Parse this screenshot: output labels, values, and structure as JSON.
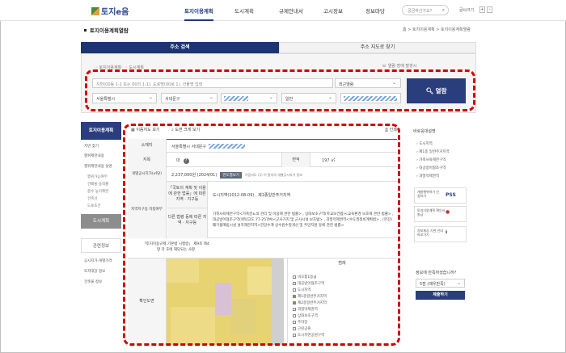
{
  "header": {
    "logo_text": "토지e음",
    "nav": [
      "토지이용계획",
      "도시계획",
      "규제안내서",
      "고시정보",
      "정보마당"
    ],
    "search_placeholder": "궁금하신가요?",
    "font_label": "글씨크기",
    "font_plus": "+",
    "font_minus": "-"
  },
  "page": {
    "title": "토지이용계획열람",
    "breadcrumb": [
      "홈",
      ">",
      "토지이용계획",
      ">",
      "토지이용계획열람"
    ]
  },
  "tabs": {
    "address_search": "주소 검색",
    "map_search": "주소 지도로 찾기"
  },
  "search": {
    "radio_land": "토지이용계획",
    "radio_city": "도시계획",
    "help_text": "열람 장애 발생시",
    "address_placeholder": "지번(00동 1-1 또는 00리 1-1), 도로명(00로 1), 건물명 입력",
    "recent_label": "최근열람",
    "sido": "서울특별시",
    "sigungu": "서대문구",
    "mountain": "일반",
    "view_button": "열람"
  },
  "sidebar": {
    "header": "토지이용계획",
    "items": [
      "지번 찾기",
      "행위제한내용",
      "행위제한내용 설명"
    ],
    "subitems": [
      "행위가능여부",
      "건폐율·용적률",
      "층수·높이제한",
      "건축선",
      "도로조건"
    ],
    "gray1": "도시계획",
    "gray2": "관련정보",
    "info_items": [
      "공시지가·개별가격",
      "토지대장 정보",
      "건축물 정보"
    ]
  },
  "toolbar": {
    "regulation_view": "이음지도 보기",
    "map_view": "도면 크게 보기",
    "print": "인쇄"
  },
  "table": {
    "location_label": "소재지",
    "location_value": "서울특별시 서대문구",
    "jimok_label": "지목",
    "jimok_value": "대",
    "area_label": "면적",
    "area_value": "197 ㎡",
    "price_label": "개별공시지가(㎡당)",
    "price_value": "2,237,000원 (2024/01)",
    "price_btn": "연도별보기",
    "price_note": "이음지도 (1) 이 필지의 개별공시지가 정보",
    "zone_label": "지역지구등 지정여부",
    "zone_sub1": "「국토의 계획 및 이용에 관한 법률」에 따른 지역 · 지구등",
    "zone_val1": "도시지역(2012-08-09) , 제1종일반주거지역",
    "zone_sub2": "다른 법령 등에 따른 지역 · 지구등",
    "zone_val2": "가축사육제한구역<가축분뇨의 관리 및 이용에 관한 법률> , 상대보호구역(학교보건법)<교육환경 보호에 관한 법률> , 대공방어협조구역(위탁고도:77-257M)<군사기지 및 군사시설 보호법> , 과밀억제권역<수도권정비계획법> , (한강)폐기물매립시설 설치제한지역<한강수계 상수원수질개선 및 주민지원 등에 관한 법률>",
    "enforce_label": "「토지이용규제 기본법 시행령」 제9조 제4항 각 호에 해당되는 사항",
    "map_label": "확인도면",
    "legend_title": "범례",
    "legend_items": [
      "비오톱1등급",
      "대공방어협조구역",
      "도시지역",
      "제1종일반주거지역",
      "제2종일반주거지역",
      "과밀억제권역",
      "상대보호구역",
      "주차장",
      "근린공원",
      "도시자연공원구역"
    ]
  },
  "right": {
    "title": "바로응대설명",
    "links": [
      "도시지역",
      "제1종 일반주거지역",
      "가축사육제한구역",
      "대공방어협조구역",
      "과밀억제권역"
    ],
    "box1_text": "개발행위허가 신청하기",
    "box1_logo": "PSS",
    "box2_text": "토지이용계획 확인서 발급",
    "box3_text": "정보제공 기관 안내 바로가기",
    "question": "정보에 만족하셨습니까?",
    "rating": "5점 (매우만족)",
    "submit": "제출하기"
  }
}
